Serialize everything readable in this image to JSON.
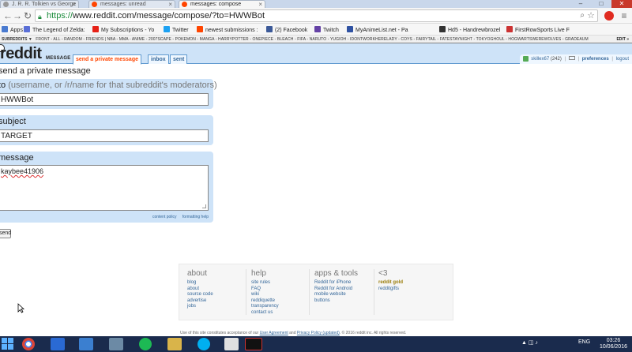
{
  "browser": {
    "tabs": [
      {
        "label": "J. R. R. Tolkien vs George"
      },
      {
        "label": "messages: unread"
      },
      {
        "label": "messages: compose"
      }
    ],
    "url_scheme": "https://",
    "url_rest": "www.reddit.com/message/compose/?to=HWWBot",
    "bookmarks": [
      {
        "label": "Apps",
        "color": "#4a7bd0"
      },
      {
        "label": "The Legend of Zelda:",
        "color": "#5a6fd6"
      },
      {
        "label": "My Subscriptions - Yo",
        "color": "#e62117"
      },
      {
        "label": "Twitter",
        "color": "#1da1f2"
      },
      {
        "label": "newest submissions :",
        "color": "#ff4500"
      },
      {
        "label": "(2) Facebook",
        "color": "#3b5998"
      },
      {
        "label": "Twitch",
        "color": "#6441a5"
      },
      {
        "label": "MyAnimeList.net - Pa",
        "color": "#2e51a2"
      },
      {
        "label": "Hd5 - Handrewbrozel",
        "color": "#333333"
      },
      {
        "label": "FirstRowSports Live F",
        "color": "#cc3333"
      }
    ]
  },
  "reddit": {
    "srbar": {
      "my_subreddits": "SUBREDDITS ▼",
      "list": "FRONT - ALL - RANDOM - FRIENDS | NBA - MMA - ANIME - 2007SCAPE - POKEMON - MANGA - HARRYPOTTER - ONEPIECE - BLEACH - FIFA - NARUTO - YUGIOH - IDONTWORKHERELADY - COYS - FAIRYTAIL - FATESTAYNIGHT - TOKYOGHOUL - HOGWARTSWEREWOLVES - GRADEAUM",
      "edit": "EDIT »"
    },
    "logo": "reddit",
    "page_name": "MESSAGE",
    "tabs": [
      "send a private message",
      "inbox",
      "sent"
    ],
    "user": {
      "name": "skillex67",
      "karma": "(242)",
      "preferences": "preferences",
      "logout": "logout"
    },
    "title": "send a private message",
    "to_label": "to",
    "to_hint": "(username, or /r/name for that subreddit's moderators)",
    "to_value": "HWWBot",
    "subject_label": "subject",
    "subject_value": "TARGET",
    "message_label": "message",
    "message_value": "kaybee41906",
    "content_policy": "content policy",
    "formatting_help": "formatting help",
    "send_label": "send"
  },
  "footer": {
    "about": {
      "heading": "about",
      "links": [
        "blog",
        "about",
        "source code",
        "advertise",
        "jobs"
      ]
    },
    "help": {
      "heading": "help",
      "links": [
        "site rules",
        "FAQ",
        "wiki",
        "reddiquette",
        "transparency",
        "contact us"
      ]
    },
    "apps": {
      "heading": "apps & tools",
      "links": [
        "Reddit for iPhone",
        "Reddit for Android",
        "mobile website",
        "buttons"
      ]
    },
    "love": {
      "heading": "<3",
      "gold": "reddit gold",
      "links": [
        "redditgifts"
      ]
    },
    "legal_pre": "Use of this site constitutes acceptance of our",
    "user_agreement": "User Agreement",
    "and": "and",
    "privacy_policy": "Privacy Policy (updated)",
    "legal_post": ". © 2016 reddit inc. All rights reserved."
  },
  "taskbar": {
    "language": "ENG",
    "time": "03:26",
    "date": "10/06/2016"
  },
  "colors": {
    "reddit_header": "#cee3f8",
    "reddit_orangered": "#ff4500",
    "link_blue": "#336699",
    "taskbar": "#1a2b4d"
  }
}
